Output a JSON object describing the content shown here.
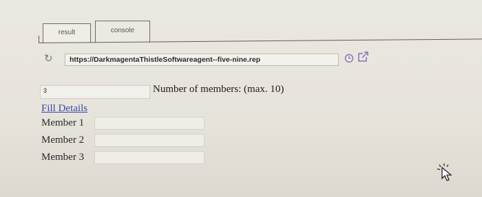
{
  "tabs": [
    {
      "label": "result"
    },
    {
      "label": "console"
    }
  ],
  "browser": {
    "url": "https://DarkmagentaThistleSoftwareagent--five-nine.rep",
    "reload_icon": "reload-icon",
    "history_icon": "clock-icon",
    "open_icon": "open-in-new-window-icon"
  },
  "form": {
    "member_count_value": "3",
    "member_count_label": "Number of members: (max. 10)",
    "fill_details_link": "Fill Details",
    "members": [
      {
        "label": "Member 1",
        "value": ""
      },
      {
        "label": "Member 2",
        "value": ""
      },
      {
        "label": "Member 3",
        "value": ""
      }
    ]
  },
  "colors": {
    "link": "#3b48a6",
    "icon_accent": "#8a6fb8"
  }
}
